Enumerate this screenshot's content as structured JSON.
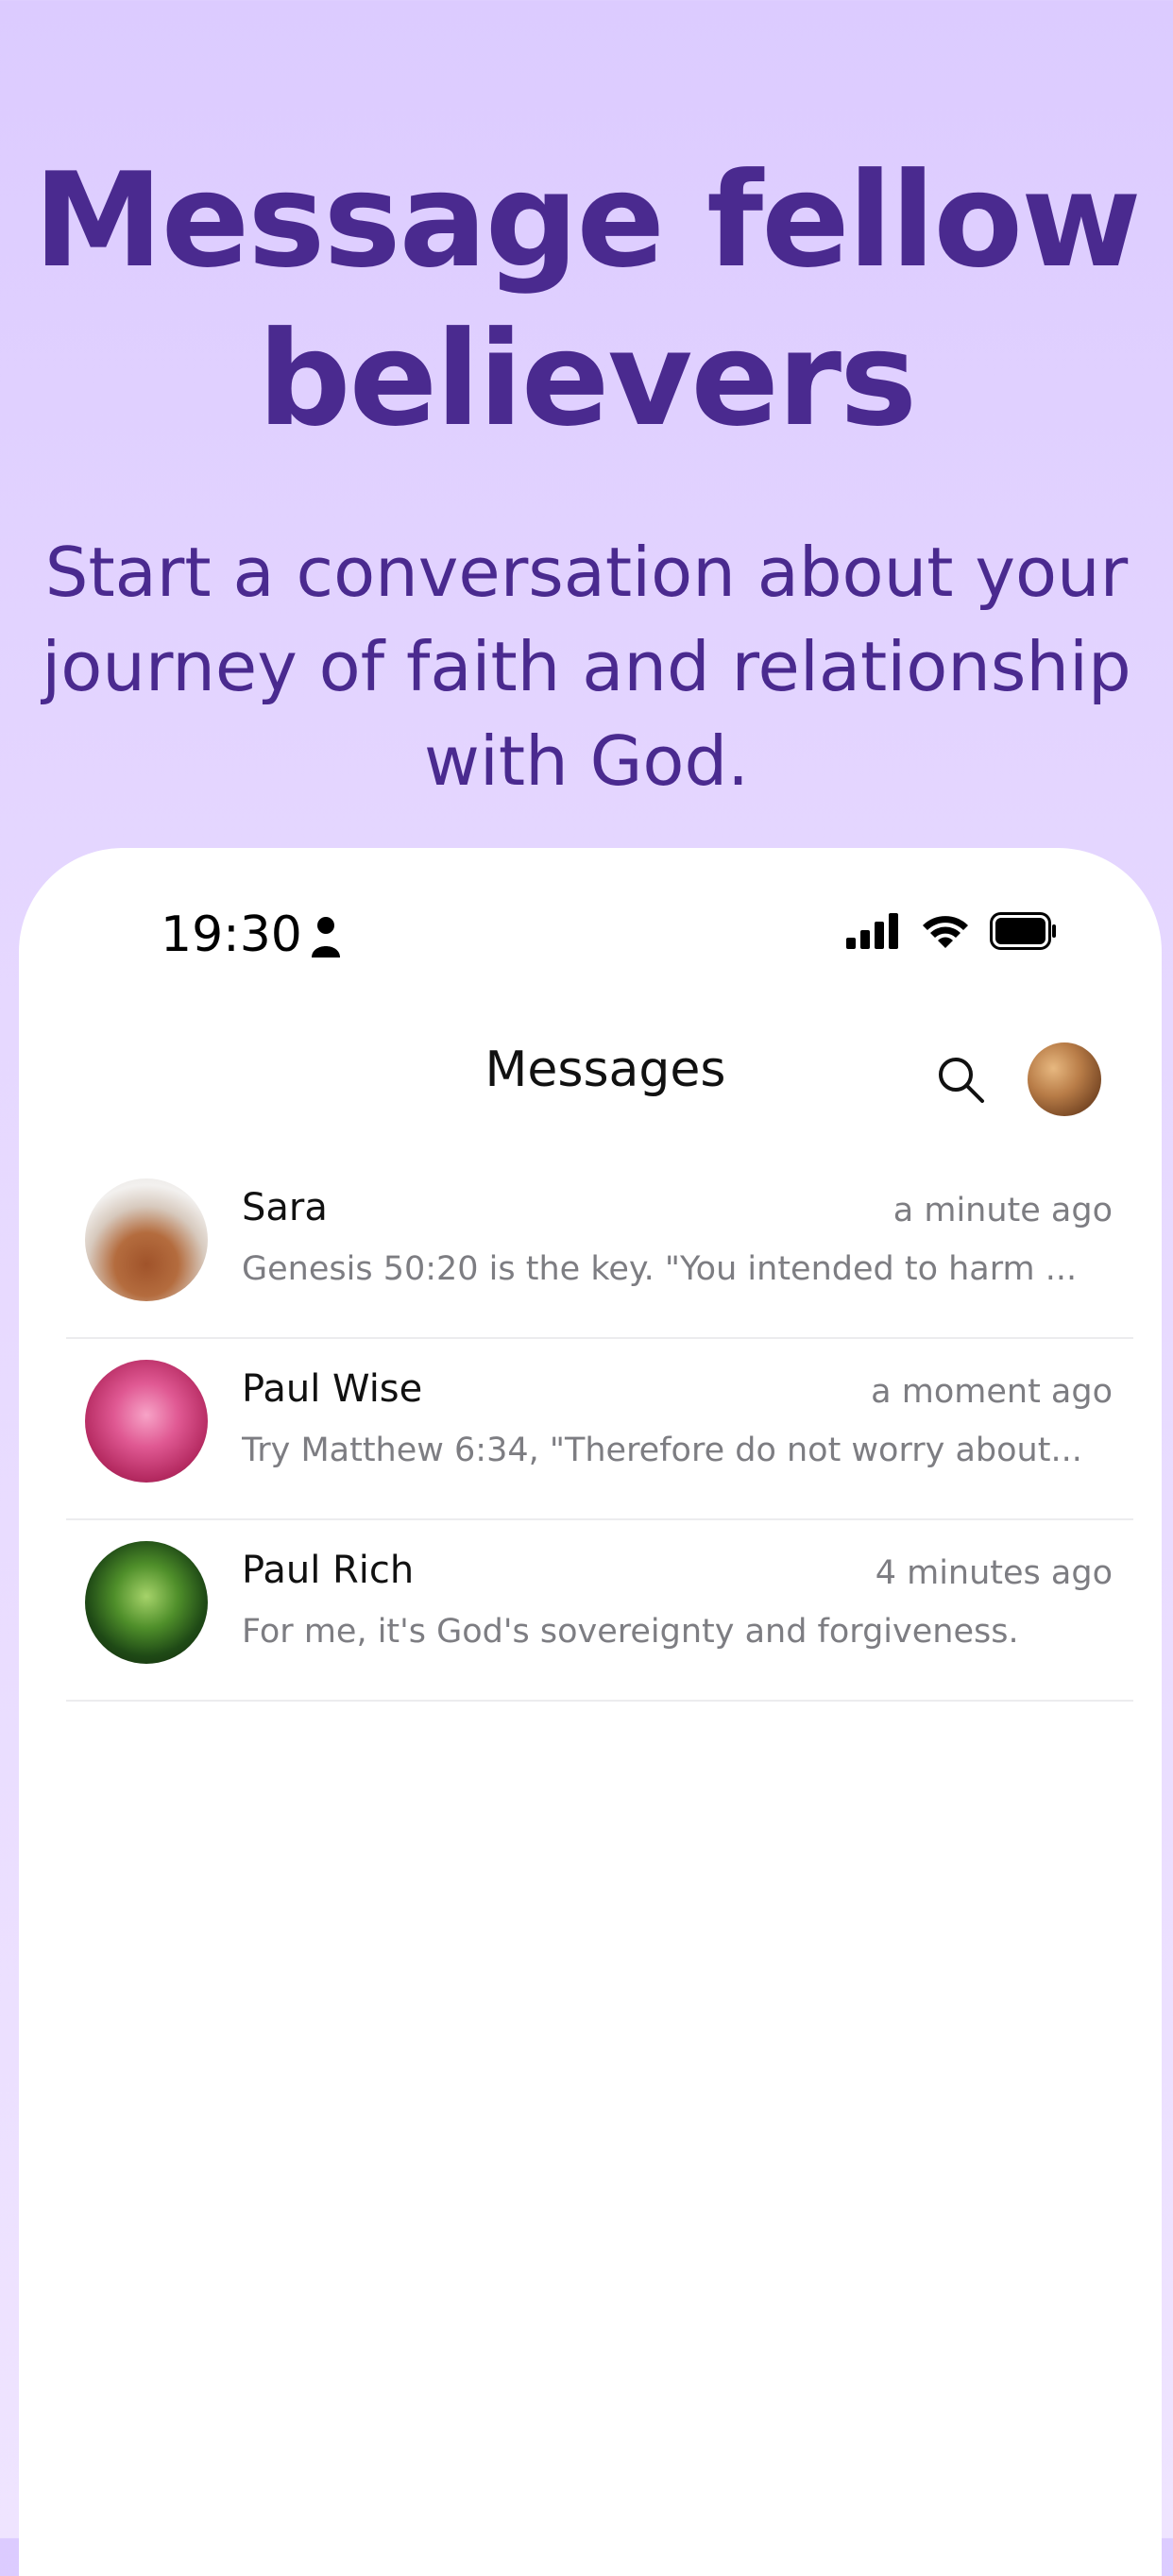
{
  "promo": {
    "headline_line1": "Message fellow",
    "headline_line2": "believers",
    "subhead_line1": "Start a conversation about your",
    "subhead_line2": "journey of faith and relationship",
    "subhead_line3": "with God."
  },
  "status_bar": {
    "time": "19:30"
  },
  "nav": {
    "title": "Messages",
    "search_icon": "search-icon",
    "profile_icon": "profile-avatar"
  },
  "conversations": [
    {
      "name": "Sara",
      "time": "a minute ago",
      "preview": "Genesis 50:20 is the key. \"You intended to harm ..."
    },
    {
      "name": "Paul Wise",
      "time": "a moment ago",
      "preview": "Try Matthew 6:34, \"Therefore do not worry about..."
    },
    {
      "name": "Paul Rich",
      "time": "4 minutes ago",
      "preview": "For me, it's God's sovereignty and forgiveness."
    }
  ],
  "colors": {
    "background": "#dccbff",
    "headline": "#4a2a8f",
    "secondary_text": "#7d7d82"
  }
}
